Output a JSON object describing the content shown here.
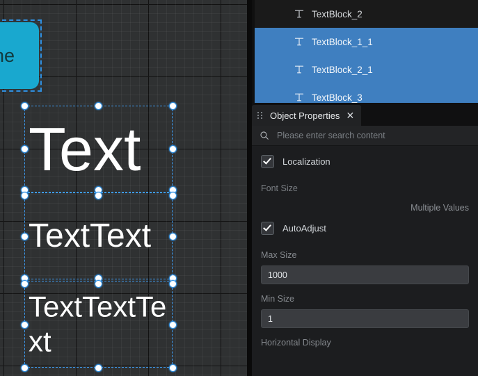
{
  "canvas": {
    "button_widget": {
      "label": "ne",
      "color": "#19a8cf"
    },
    "text_blocks": [
      {
        "text": "Text"
      },
      {
        "text": "TextText"
      },
      {
        "text": "TextTextText"
      }
    ]
  },
  "tree": {
    "items": [
      {
        "label": "TextBlock_2",
        "icon": "textblock-icon",
        "selected": false
      },
      {
        "label": "TextBlock_1_1",
        "icon": "textblock-icon",
        "selected": true
      },
      {
        "label": "TextBlock_2_1",
        "icon": "textblock-icon",
        "selected": true
      },
      {
        "label": "TextBlock_3",
        "icon": "textblock-icon",
        "selected": true
      }
    ],
    "selection_color": "#3f7fc0"
  },
  "properties_panel": {
    "tab_title": "Object Properties",
    "close_icon": "✕",
    "search": {
      "placeholder": "Please enter search content",
      "value": "",
      "icon": "search-icon"
    },
    "fields": {
      "localization_label": "Localization",
      "localization_checked": true,
      "font_size_label": "Font Size",
      "font_size_value": "Multiple Values",
      "autoadjust_label": "AutoAdjust",
      "autoadjust_checked": true,
      "max_size_label": "Max Size",
      "max_size_value": "1000",
      "min_size_label": "Min Size",
      "min_size_value": "1",
      "horizontal_display_label": "Horizontal Display"
    }
  }
}
